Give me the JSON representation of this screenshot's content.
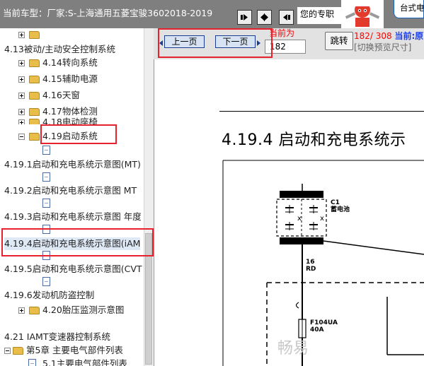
{
  "header": {
    "car_label": "当前车型：",
    "car_value": "厂家:S-上海通用五菱宝骏3602018-2019",
    "brand_text": "您的专职",
    "brand_box": "台式电"
  },
  "tree": {
    "items": [
      {
        "type": "folder",
        "label": ""
      },
      {
        "type": "category",
        "label": "4.13被动/主动安全控制系统"
      },
      {
        "type": "folder",
        "label": "4.14转向系统"
      },
      {
        "type": "folder",
        "label": "4.15辅助电源"
      },
      {
        "type": "folder",
        "label": "4.16天窗"
      },
      {
        "type": "folder",
        "label": "4.17物体检测"
      },
      {
        "type": "folder",
        "label": "4.18电动座椅"
      },
      {
        "type": "folder-open",
        "label": "4.19启动系统"
      },
      {
        "type": "doc",
        "label": ""
      },
      {
        "type": "page",
        "label": "4.19.1启动和充电系统示意图(MT)"
      },
      {
        "type": "doc",
        "label": ""
      },
      {
        "type": "page",
        "label": "4.19.2启动和充电系统示意图 MT"
      },
      {
        "type": "doc",
        "label": ""
      },
      {
        "type": "page",
        "label": "4.19.3启动和充电系统示意图 年度"
      },
      {
        "type": "doc",
        "label": ""
      },
      {
        "type": "page",
        "label": "4.19.4启动和充电系统示意图(iAM"
      },
      {
        "type": "doc",
        "label": ""
      },
      {
        "type": "page",
        "label": "4.19.5启动和充电系统示意图(CVT"
      },
      {
        "type": "doc",
        "label": ""
      },
      {
        "type": "page",
        "label": "4.19.6发动机防盗控制"
      },
      {
        "type": "folder",
        "label": "4.20胎压监测示意图"
      },
      {
        "type": "category",
        "label": "4.21 IAMT变速器控制系统"
      },
      {
        "type": "folder-open",
        "label": "第5章 主要电气部件列表"
      },
      {
        "type": "page",
        "label": "5.1主要电气部件列表"
      }
    ]
  },
  "toolbar": {
    "prev_label": "上一页",
    "next_label": "下一页",
    "current_label": "当前为",
    "current_value": "182",
    "jump_label": "跳转",
    "page_count": "182/ 308",
    "page_current_label": "当前:原",
    "preview_size": "[切换预览尺寸]"
  },
  "document": {
    "title": "4.19.4 启动和充电系统示",
    "battery_label": "C1",
    "battery_name": "蓄电池",
    "wire_number": "16",
    "wire_color": "RD",
    "fuse_label": "F104UA",
    "fuse_rating": "40A",
    "watermark": "畅易"
  },
  "colors": {
    "header_bg": "#7f7f7f",
    "highlight": "#e8212f",
    "page_btn_bg": "#d7e3f3",
    "folder": "#e9bd4a"
  }
}
